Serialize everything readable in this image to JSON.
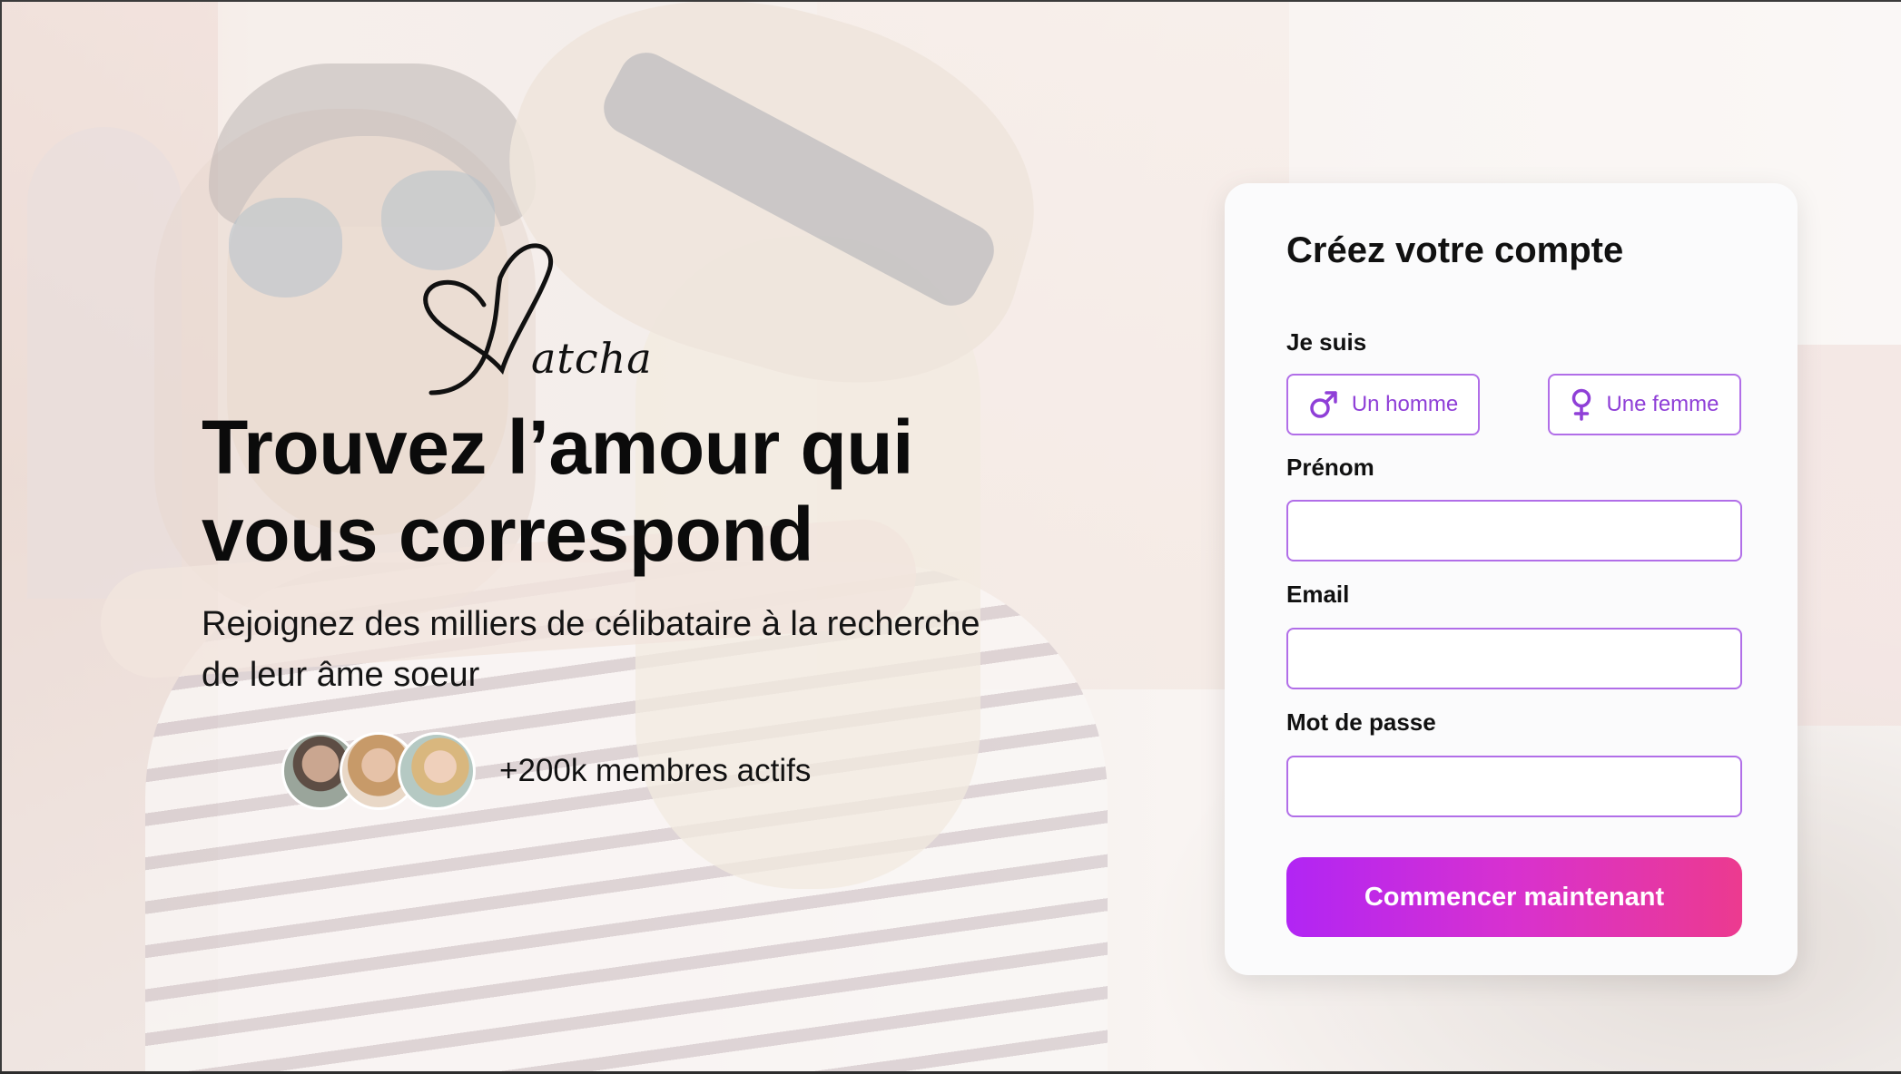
{
  "brand": {
    "logo_text": "atcha"
  },
  "hero": {
    "title": "Trouvez l’amour qui vous correspond",
    "subtitle": "Rejoignez des milliers de célibataire à la recherche de leur âme soeur",
    "members_label": "+200k membres actifs"
  },
  "signup": {
    "title": "Créez votre compte",
    "gender_label": "Je suis",
    "gender_options": [
      {
        "label": "Un homme",
        "icon": "male-symbol-icon"
      },
      {
        "label": "Une femme",
        "icon": "female-symbol-icon"
      }
    ],
    "firstname_label": "Prénom",
    "firstname_value": "",
    "email_label": "Email",
    "email_value": "",
    "password_label": "Mot de passe",
    "password_value": "",
    "submit_label": "Commencer maintenant"
  },
  "colors": {
    "accent_purple": "#b16ee8",
    "accent_text": "#8f3fd7",
    "button_gradient_start": "#b125f4",
    "button_gradient_end": "#ec3a8f"
  }
}
